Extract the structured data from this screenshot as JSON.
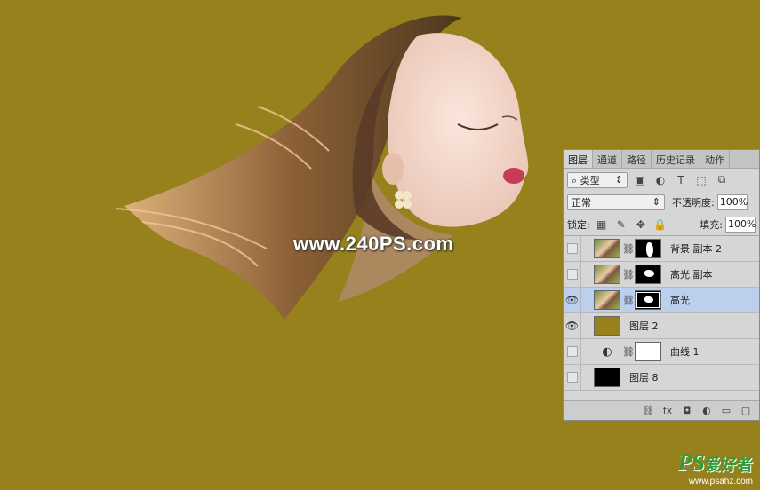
{
  "watermark": "www.240PS.com",
  "corner_logo": {
    "brand": "PS",
    "brand_cn": "爱好者",
    "url": "www.psahz.com"
  },
  "colors": {
    "background": "#96811c",
    "selected_layer": "#bcd0ee",
    "panel": "#d6d6d6"
  },
  "layers_panel": {
    "tabs": [
      "图层",
      "通道",
      "路径",
      "历史记录",
      "动作"
    ],
    "filter": {
      "label": "类型",
      "search_icon": "search-icon"
    },
    "filter_icons": [
      "image-filter-icon",
      "adjustment-filter-icon",
      "type-filter-icon",
      "shape-filter-icon",
      "smart-object-filter-icon"
    ],
    "filter_glyphs": [
      "▣",
      "◐",
      "T",
      "⬚",
      "⧉"
    ],
    "blend_mode": "正常",
    "opacity_label": "不透明度:",
    "opacity_value": "100%",
    "lock_label": "锁定:",
    "lock_glyphs": [
      "▦",
      "✎",
      "✥",
      "🔒"
    ],
    "fill_label": "填充:",
    "fill_value": "100%",
    "layers": [
      {
        "name": "背景 副本 2",
        "visible": false,
        "selected": false
      },
      {
        "name": "高光 副本",
        "visible": false,
        "selected": false
      },
      {
        "name": "高光",
        "visible": true,
        "selected": true
      },
      {
        "name": "图层 2",
        "visible": true,
        "selected": false
      },
      {
        "name": "曲线 1",
        "visible": false,
        "selected": false
      },
      {
        "name": "图层 8",
        "visible": false,
        "selected": false
      }
    ],
    "bottom_glyphs": [
      "⛓",
      "fx",
      "◘",
      "◐",
      "▭",
      "▢"
    ]
  }
}
